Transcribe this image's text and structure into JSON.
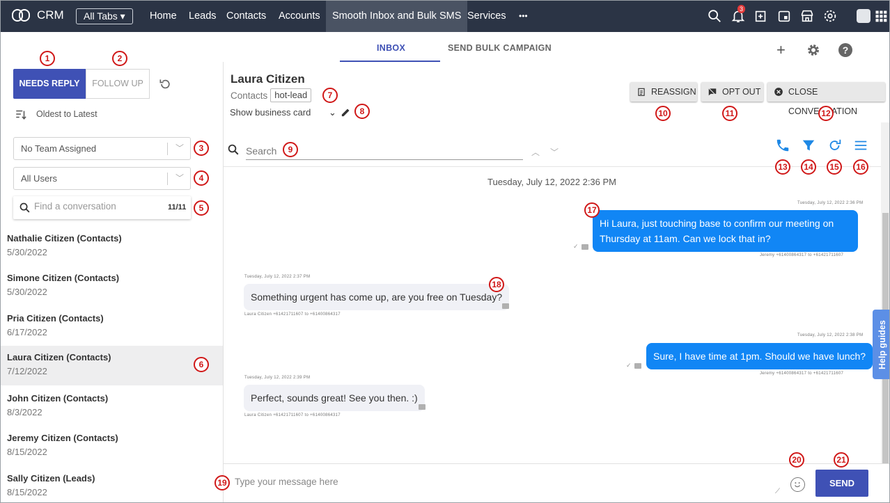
{
  "nav": {
    "brand": "CRM",
    "all_tabs": "All Tabs",
    "links": [
      "Home",
      "Leads",
      "Contacts",
      "Accounts",
      "Smooth Inbox and Bulk SMS",
      "Services",
      "•••"
    ],
    "notification_count": "3"
  },
  "tabs": {
    "inbox": "INBOX",
    "bulk": "SEND BULK CAMPAIGN"
  },
  "left": {
    "needs_reply": "NEEDS REPLY",
    "follow_up": "FOLLOW UP",
    "sort": "Oldest to Latest",
    "team": "No Team Assigned",
    "users": "All Users",
    "find_placeholder": "Find a conversation",
    "count": "11/11",
    "conversations": [
      {
        "name": "Nathalie Citizen (Contacts)",
        "date": "5/30/2022"
      },
      {
        "name": "Simone Citizen (Contacts)",
        "date": "5/30/2022"
      },
      {
        "name": "Pria Citizen (Contacts)",
        "date": "6/17/2022"
      },
      {
        "name": "Laura Citizen (Contacts)",
        "date": "7/12/2022"
      },
      {
        "name": "John Citizen (Contacts)",
        "date": "8/3/2022"
      },
      {
        "name": "Jeremy Citizen (Contacts)",
        "date": "8/15/2022"
      },
      {
        "name": "Sally Citizen (Leads)",
        "date": "8/15/2022"
      }
    ]
  },
  "contact": {
    "name": "Laura Citizen",
    "module": "Contacts",
    "tag": "hot-lead",
    "business_card": "Show business card"
  },
  "actions": {
    "reassign": "REASSIGN",
    "opt_out": "OPT OUT",
    "close": "CLOSE CONVERSATION"
  },
  "search_placeholder": "Search",
  "chat": {
    "date_header": "Tuesday, July 12, 2022 2:36 PM",
    "messages": [
      {
        "dir": "out",
        "time": "Tuesday, July 12, 2022 2:36 PM",
        "text": "Hi Laura, just touching base to confirm our meeting on Thursday at 11am. Can we lock that in?",
        "route": "Jeremy +61400864317 to +61421711607"
      },
      {
        "dir": "in",
        "time": "Tuesday, July 12, 2022 2:37 PM",
        "text": "Something urgent has come up, are you free on Tuesday?",
        "route": "Laura Citizen +61421711607 to +61400864317"
      },
      {
        "dir": "out",
        "time": "Tuesday, July 12, 2022 2:38 PM",
        "text": "Sure, I have time at 1pm. Should we have lunch?",
        "route": "Jeremy +61400864317 to +61421711607"
      },
      {
        "dir": "in",
        "time": "Tuesday, July 12, 2022 2:39 PM",
        "text": "Perfect, sounds great! See you then. :)",
        "route": "Laura Citizen +61421711607 to +61400864317"
      }
    ]
  },
  "composer": {
    "placeholder": "Type your message here",
    "send": "SEND"
  },
  "help": "Help guides",
  "markers": [
    "1",
    "2",
    "3",
    "4",
    "5",
    "6",
    "7",
    "8",
    "9",
    "10",
    "11",
    "12",
    "13",
    "14",
    "15",
    "16",
    "17",
    "18",
    "19",
    "20",
    "21"
  ],
  "colors": {
    "accent": "#3f51b5",
    "bubble_out": "#1186f5",
    "nav_bg": "#2b3445",
    "marker": "#d01818"
  },
  "icons": [
    "search-icon",
    "bell-icon",
    "add-icon",
    "calendar-icon",
    "store-icon",
    "gear-icon",
    "apps-grid-icon",
    "refresh-icon",
    "sort-icon",
    "phone-icon",
    "filter-icon",
    "redo-icon",
    "menu-icon",
    "emoji-icon",
    "help-icon",
    "pencil-icon"
  ]
}
